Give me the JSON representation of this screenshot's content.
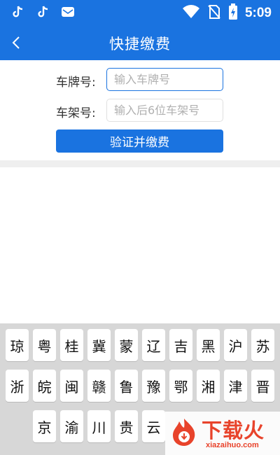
{
  "status_bar": {
    "time": "5:09",
    "left_icons": [
      "tiktok-icon",
      "tiktok-icon",
      "mail-icon"
    ],
    "right_icons": [
      "wifi-icon",
      "no-sim-icon",
      "battery-charging-icon"
    ]
  },
  "app_bar": {
    "back_icon": "chevron-left-icon",
    "title": "快捷缴费"
  },
  "form": {
    "plate_label": "车牌号:",
    "plate_placeholder": "输入车牌号",
    "frame_label": "车架号:",
    "frame_placeholder": "输入后6位车架号",
    "submit_label": "验证并缴费"
  },
  "keyboard": {
    "rows": [
      [
        "琼",
        "粤",
        "桂",
        "冀",
        "蒙",
        "辽",
        "吉",
        "黑",
        "沪",
        "苏"
      ],
      [
        "浙",
        "皖",
        "闽",
        "赣",
        "鲁",
        "豫",
        "鄂",
        "湘",
        "津",
        "晋"
      ],
      [
        "京",
        "渝",
        "川",
        "贵",
        "云"
      ]
    ]
  },
  "watermark": {
    "text": "下载火",
    "url": "xiazaihuo.com"
  },
  "colors": {
    "primary": "#1a73e0",
    "keyboard_bg": "#d7d7d7",
    "watermark": "#e8432b"
  }
}
